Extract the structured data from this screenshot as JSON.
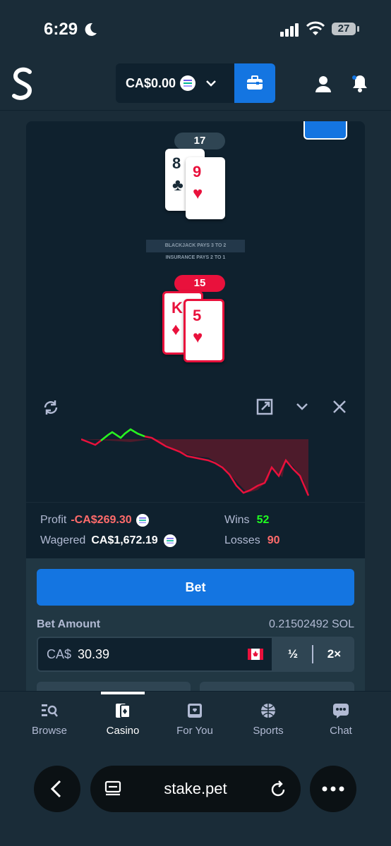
{
  "status_bar": {
    "time": "6:29",
    "battery": "27"
  },
  "header": {
    "balance": "CA$0.00"
  },
  "game": {
    "dealer_score": "17",
    "dealer_cards": [
      {
        "rank": "8",
        "suit": "♣"
      },
      {
        "rank": "9",
        "suit": "♥"
      }
    ],
    "banner_line1": "BLACKJACK PAYS 3 TO 2",
    "banner_line2": "INSURANCE PAYS 2 TO 1",
    "player_score": "15",
    "player_cards": [
      {
        "rank": "K",
        "suit": "♦"
      },
      {
        "rank": "5",
        "suit": "♥"
      }
    ]
  },
  "stats": {
    "profit_label": "Profit",
    "profit_value": "-CA$269.30",
    "wagered_label": "Wagered",
    "wagered_value": "CA$1,672.19",
    "wins_label": "Wins",
    "wins_value": "52",
    "losses_label": "Losses",
    "losses_value": "90"
  },
  "bet": {
    "button_label": "Bet",
    "amount_label": "Bet Amount",
    "sol_value": "0.21502492 SOL",
    "currency_prefix": "CA$",
    "amount_value": "30.39",
    "half_label": "½",
    "double_label": "2×"
  },
  "bottom_nav": {
    "items": [
      {
        "label": "Browse",
        "icon": "browse-icon"
      },
      {
        "label": "Casino",
        "icon": "casino-icon"
      },
      {
        "label": "For You",
        "icon": "for-you-icon"
      },
      {
        "label": "Sports",
        "icon": "sports-icon"
      },
      {
        "label": "Chat",
        "icon": "chat-icon"
      }
    ],
    "active_index": 1
  },
  "browser": {
    "url": "stake.pet"
  },
  "colors": {
    "accent": "#1475e1",
    "profit_negative": "#ff6b6b",
    "wins": "#1fff20",
    "losses": "#ff6b6b",
    "background": "#1a2c38"
  }
}
